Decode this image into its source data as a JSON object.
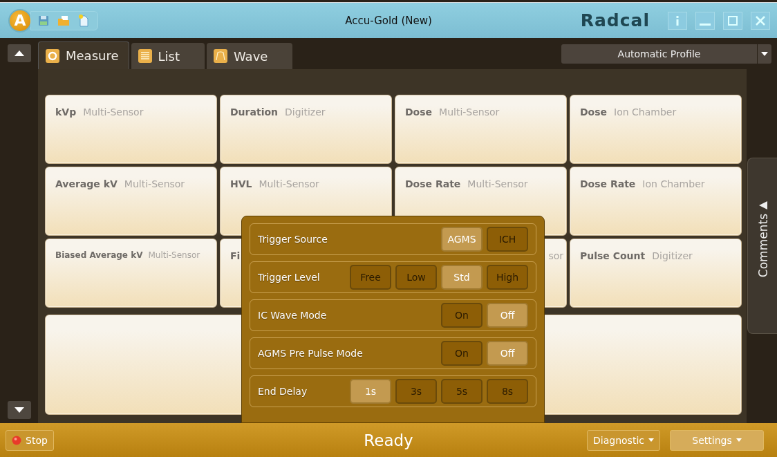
{
  "window": {
    "logo_letter": "A",
    "title": "Accu-Gold  (New)",
    "brand": "Radcal"
  },
  "tabs": [
    {
      "label": "Measure",
      "kind": "measure",
      "selected": true
    },
    {
      "label": "List",
      "kind": "list",
      "selected": false
    },
    {
      "label": "Wave",
      "kind": "wave",
      "selected": false
    }
  ],
  "profile": {
    "value": "Automatic Profile"
  },
  "cards": [
    {
      "label": "kVp",
      "source": "Multi-Sensor"
    },
    {
      "label": "Duration",
      "source": "Digitizer"
    },
    {
      "label": "Dose",
      "source": "Multi-Sensor"
    },
    {
      "label": "Dose",
      "source": "Ion Chamber"
    },
    {
      "label": "Average kV",
      "source": "Multi-Sensor"
    },
    {
      "label": "HVL",
      "source": "Multi-Sensor"
    },
    {
      "label": "Dose Rate",
      "source": "Multi-Sensor"
    },
    {
      "label": "Dose Rate",
      "source": "Ion Chamber"
    },
    {
      "label": "Biased Average kV",
      "source": "Multi-Sensor"
    },
    {
      "label": "Fi"
    },
    {
      "source": "sor"
    },
    {
      "label": "Pulse Count",
      "source": "Digitizer"
    },
    {
      "kind": "wide"
    }
  ],
  "comments": {
    "label": "Comments"
  },
  "popup": {
    "rows": [
      {
        "label": "Trigger Source",
        "options": [
          {
            "label": "AGMS",
            "selected": true
          },
          {
            "label": "ICH",
            "selected": false
          }
        ]
      },
      {
        "label": "Trigger Level",
        "options": [
          {
            "label": "Free",
            "selected": false
          },
          {
            "label": "Low",
            "selected": false
          },
          {
            "label": "Std",
            "selected": true
          },
          {
            "label": "High",
            "selected": false
          }
        ]
      },
      {
        "label": "IC Wave Mode",
        "options": [
          {
            "label": "On",
            "selected": false
          },
          {
            "label": "Off",
            "selected": true
          }
        ]
      },
      {
        "label": "AGMS Pre Pulse Mode",
        "options": [
          {
            "label": "On",
            "selected": false
          },
          {
            "label": "Off",
            "selected": true
          }
        ]
      },
      {
        "label": "End Delay",
        "options": [
          {
            "label": "1s",
            "selected": true
          },
          {
            "label": "3s",
            "selected": false
          },
          {
            "label": "5s",
            "selected": false
          },
          {
            "label": "8s",
            "selected": false
          }
        ]
      }
    ]
  },
  "status_bar": {
    "stop": "Stop",
    "status": "Ready",
    "diagnostic": "Diagnostic",
    "settings": "Settings"
  }
}
